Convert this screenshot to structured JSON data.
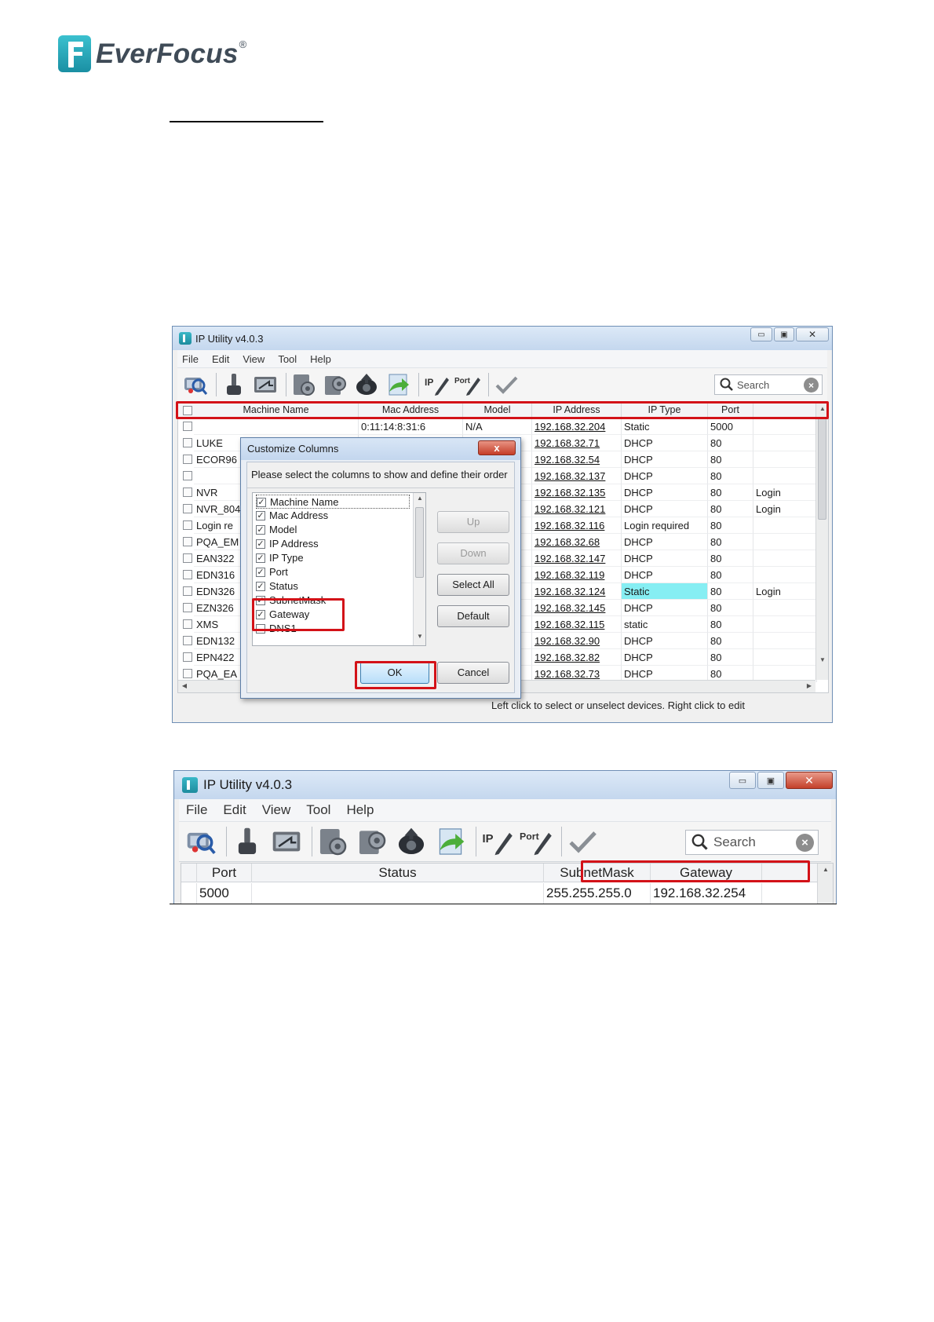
{
  "brand": {
    "name": "EverFocus",
    "reg": "®"
  },
  "window1": {
    "title": "IP Utility v4.0.3",
    "menu": [
      "File",
      "Edit",
      "View",
      "Tool",
      "Help"
    ],
    "search_placeholder": "Search",
    "columns": [
      "Machine Name",
      "Mac Address",
      "Model",
      "IP Address",
      "IP Type",
      "Port"
    ],
    "rows": [
      {
        "name": "",
        "mac": "0:11:14:8:31:6",
        "model": "N/A",
        "ip": "192.168.32.204",
        "type": "Static",
        "port": "5000",
        "extra": ""
      },
      {
        "name": "LUKE",
        "mac": "",
        "model": "",
        "ip": "192.168.32.71",
        "type": "DHCP",
        "port": "80",
        "extra": ""
      },
      {
        "name": "ECOR96",
        "mac": "",
        "model": "",
        "ip": "192.168.32.54",
        "type": "DHCP",
        "port": "80",
        "extra": ""
      },
      {
        "name": "",
        "mac": "",
        "model": "",
        "ip": "192.168.32.137",
        "type": "DHCP",
        "port": "80",
        "extra": ""
      },
      {
        "name": "NVR",
        "mac": "",
        "model": "",
        "ip": "192.168.32.135",
        "type": "DHCP",
        "port": "80",
        "extra": "Login"
      },
      {
        "name": "NVR_804",
        "mac": "",
        "model": "",
        "ip": "192.168.32.121",
        "type": "DHCP",
        "port": "80",
        "extra": "Login"
      },
      {
        "name": "Login re",
        "mac": "",
        "model": "",
        "ip": "192.168.32.116",
        "type": "Login required",
        "port": "80",
        "extra": ""
      },
      {
        "name": "PQA_EM",
        "mac": "",
        "model": "",
        "ip": "192.168.32.68",
        "type": "DHCP",
        "port": "80",
        "extra": ""
      },
      {
        "name": "EAN322",
        "mac": "",
        "model": "",
        "ip": "192.168.32.147",
        "type": "DHCP",
        "port": "80",
        "extra": ""
      },
      {
        "name": "EDN316",
        "mac": "",
        "model": "",
        "ip": "192.168.32.119",
        "type": "DHCP",
        "port": "80",
        "extra": ""
      },
      {
        "name": "EDN326",
        "mac": "",
        "model": "",
        "ip": "192.168.32.124",
        "type": "Static",
        "port": "80",
        "extra": "Login"
      },
      {
        "name": "EZN326",
        "mac": "",
        "model": "",
        "ip": "192.168.32.145",
        "type": "DHCP",
        "port": "80",
        "extra": ""
      },
      {
        "name": "XMS",
        "mac": "",
        "model": "",
        "ip": "192.168.32.115",
        "type": "static",
        "port": "80",
        "extra": ""
      },
      {
        "name": "EDN132",
        "mac": "",
        "model": "",
        "ip": "192.168.32.90",
        "type": "DHCP",
        "port": "80",
        "extra": ""
      },
      {
        "name": "EPN422",
        "mac": "",
        "model": "",
        "ip": "192.168.32.82",
        "type": "DHCP",
        "port": "80",
        "extra": ""
      },
      {
        "name": "PQA_EA",
        "mac": "",
        "model": "",
        "ip": "192.168.32.73",
        "type": "DHCP",
        "port": "80",
        "extra": ""
      }
    ],
    "status_text": "Left click to select or unselect devices. Right click to edit"
  },
  "dialog": {
    "title": "Customize Columns",
    "close_label": "x",
    "prompt": "Please select the columns to show and define their order",
    "items": [
      {
        "label": "Machine Name",
        "checked": true
      },
      {
        "label": "Mac Address",
        "checked": true
      },
      {
        "label": "Model",
        "checked": true
      },
      {
        "label": "IP Address",
        "checked": true
      },
      {
        "label": "IP Type",
        "checked": true
      },
      {
        "label": "Port",
        "checked": true
      },
      {
        "label": "Status",
        "checked": true
      },
      {
        "label": "SubnetMask",
        "checked": true
      },
      {
        "label": "Gateway",
        "checked": true
      },
      {
        "label": "DNS1",
        "checked": false
      }
    ],
    "buttons": {
      "up": "Up",
      "down": "Down",
      "select_all": "Select All",
      "default": "Default",
      "ok": "OK",
      "cancel": "Cancel"
    }
  },
  "window2": {
    "title": "IP Utility v4.0.3",
    "menu": [
      "File",
      "Edit",
      "View",
      "Tool",
      "Help"
    ],
    "search_placeholder": "Search",
    "columns": [
      "Port",
      "Status",
      "SubnetMask",
      "Gateway"
    ],
    "row": {
      "port": "5000",
      "status": "",
      "subnet": "255.255.255.0",
      "gateway": "192.168.32.254"
    }
  },
  "toolbar_icons": [
    "search-device-icon",
    "usb-tool-icon",
    "remote-connect-icon",
    "device-settings-icon",
    "batch-settings-icon",
    "camera-upgrade-icon",
    "export-icon",
    "ip-edit-icon",
    "port-edit-icon",
    "checkmark-icon"
  ],
  "colors": {
    "highlight_red": "#d31218",
    "selected_cell": "#86eef3",
    "brand_teal": "#2aa7b8"
  }
}
